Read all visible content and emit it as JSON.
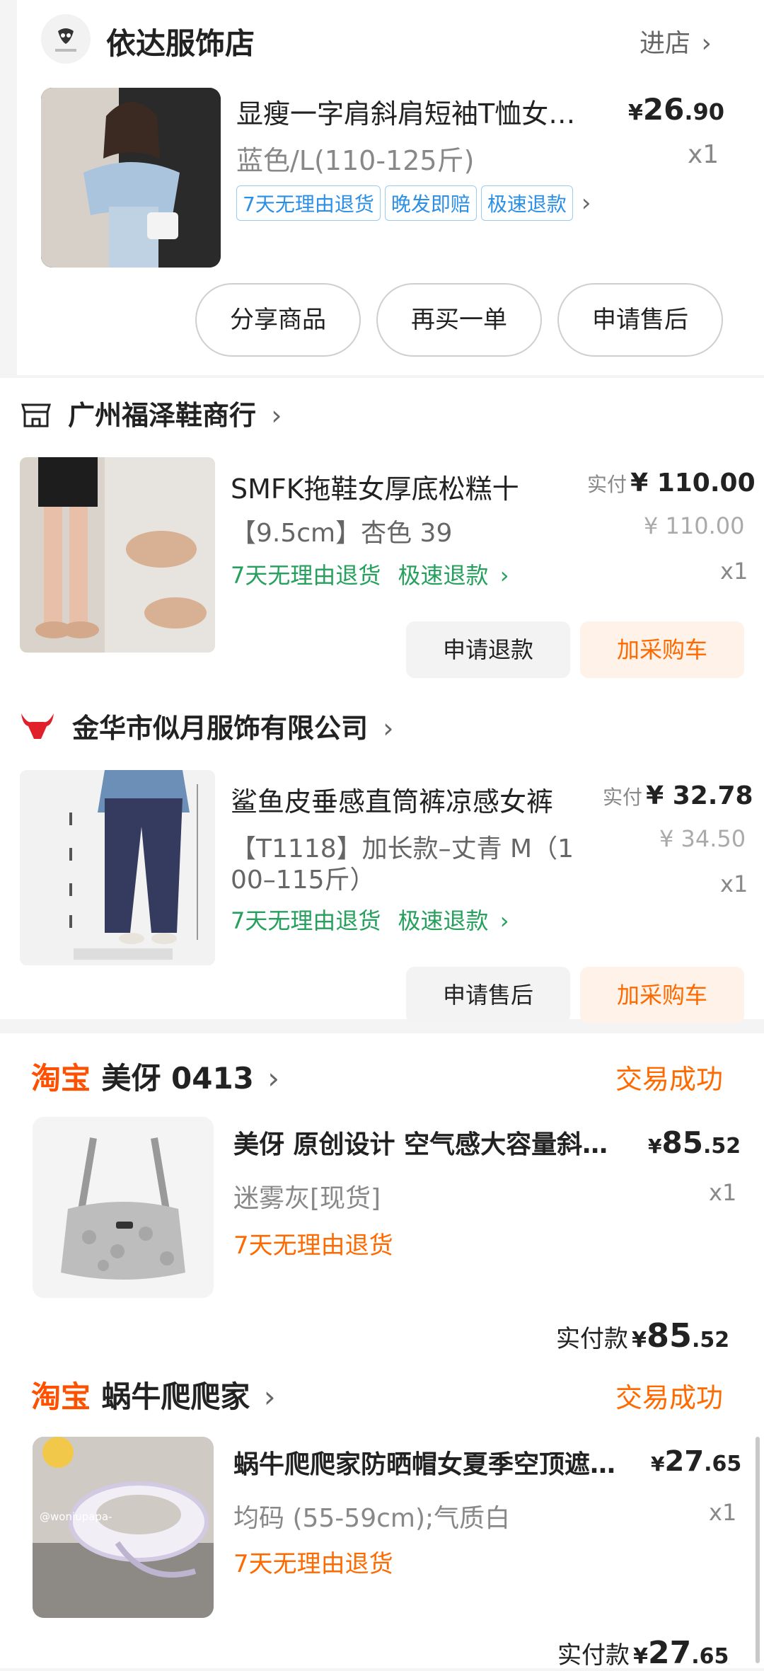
{
  "section1": {
    "shop_name": "依达服饰店",
    "enter_label": "进店",
    "item": {
      "title": "显瘦一字肩斜肩短袖T恤女…",
      "price_prefix": "¥",
      "price_int": "26",
      "price_dec": ".90",
      "variant": "蓝色/L(110-125斤)",
      "qty": "x1",
      "tags": [
        "7天无理由退货",
        "晚发即赔",
        "极速退款"
      ]
    },
    "buttons": [
      "分享商品",
      "再买一单",
      "申请售后"
    ]
  },
  "section2": {
    "shop_name": "广州福泽鞋商行",
    "item": {
      "title": "SMFK拖鞋女厚底松糕十",
      "variant": "【9.5cm】杏色 39",
      "paid_label": "实付",
      "paid_price": "¥ 110.00",
      "orig_price": "¥ 110.00",
      "qty": "x1",
      "service_a": "7天无理由退货",
      "service_b": "极速退款"
    },
    "buttons": [
      "申请退款",
      "加采购车"
    ]
  },
  "section3": {
    "shop_name": "金华市似月服饰有限公司",
    "item": {
      "title": "鲨鱼皮垂感直筒裤凉感女裤",
      "variant_line1": "【T1118】加长款–丈青 M（1",
      "variant_line2": "00–115斤）",
      "paid_label": "实付",
      "paid_price": "¥ 32.78",
      "orig_price": "¥ 34.50",
      "qty": "x1",
      "service_a": "7天无理由退货",
      "service_b": "极速退款"
    },
    "buttons": [
      "申请售后",
      "加采购车"
    ]
  },
  "section4": {
    "brand": "淘宝",
    "shop_name": "美伢 0413",
    "status": "交易成功",
    "item": {
      "title": "美伢 原创设计 空气感大容量斜…",
      "price_prefix": "¥",
      "price_int": "85",
      "price_dec": ".52",
      "variant": "迷雾灰[现货]",
      "qty": "x1",
      "service": "7天无理由退货"
    },
    "paid_label": "实付款",
    "paid_prefix": "¥",
    "paid_int": "85",
    "paid_dec": ".52"
  },
  "section5": {
    "brand": "淘宝",
    "shop_name": "蜗牛爬爬家",
    "status": "交易成功",
    "item": {
      "title": "蜗牛爬爬家防晒帽女夏季空顶遮…",
      "price_prefix": "¥",
      "price_int": "27",
      "price_dec": ".65",
      "variant": "均码 (55-59cm);气质白",
      "qty": "x1",
      "service": "7天无理由退货",
      "watermark": "@woniupapa-"
    },
    "paid_label": "实付款",
    "paid_prefix": "¥",
    "paid_int": "27",
    "paid_dec": ".65"
  }
}
